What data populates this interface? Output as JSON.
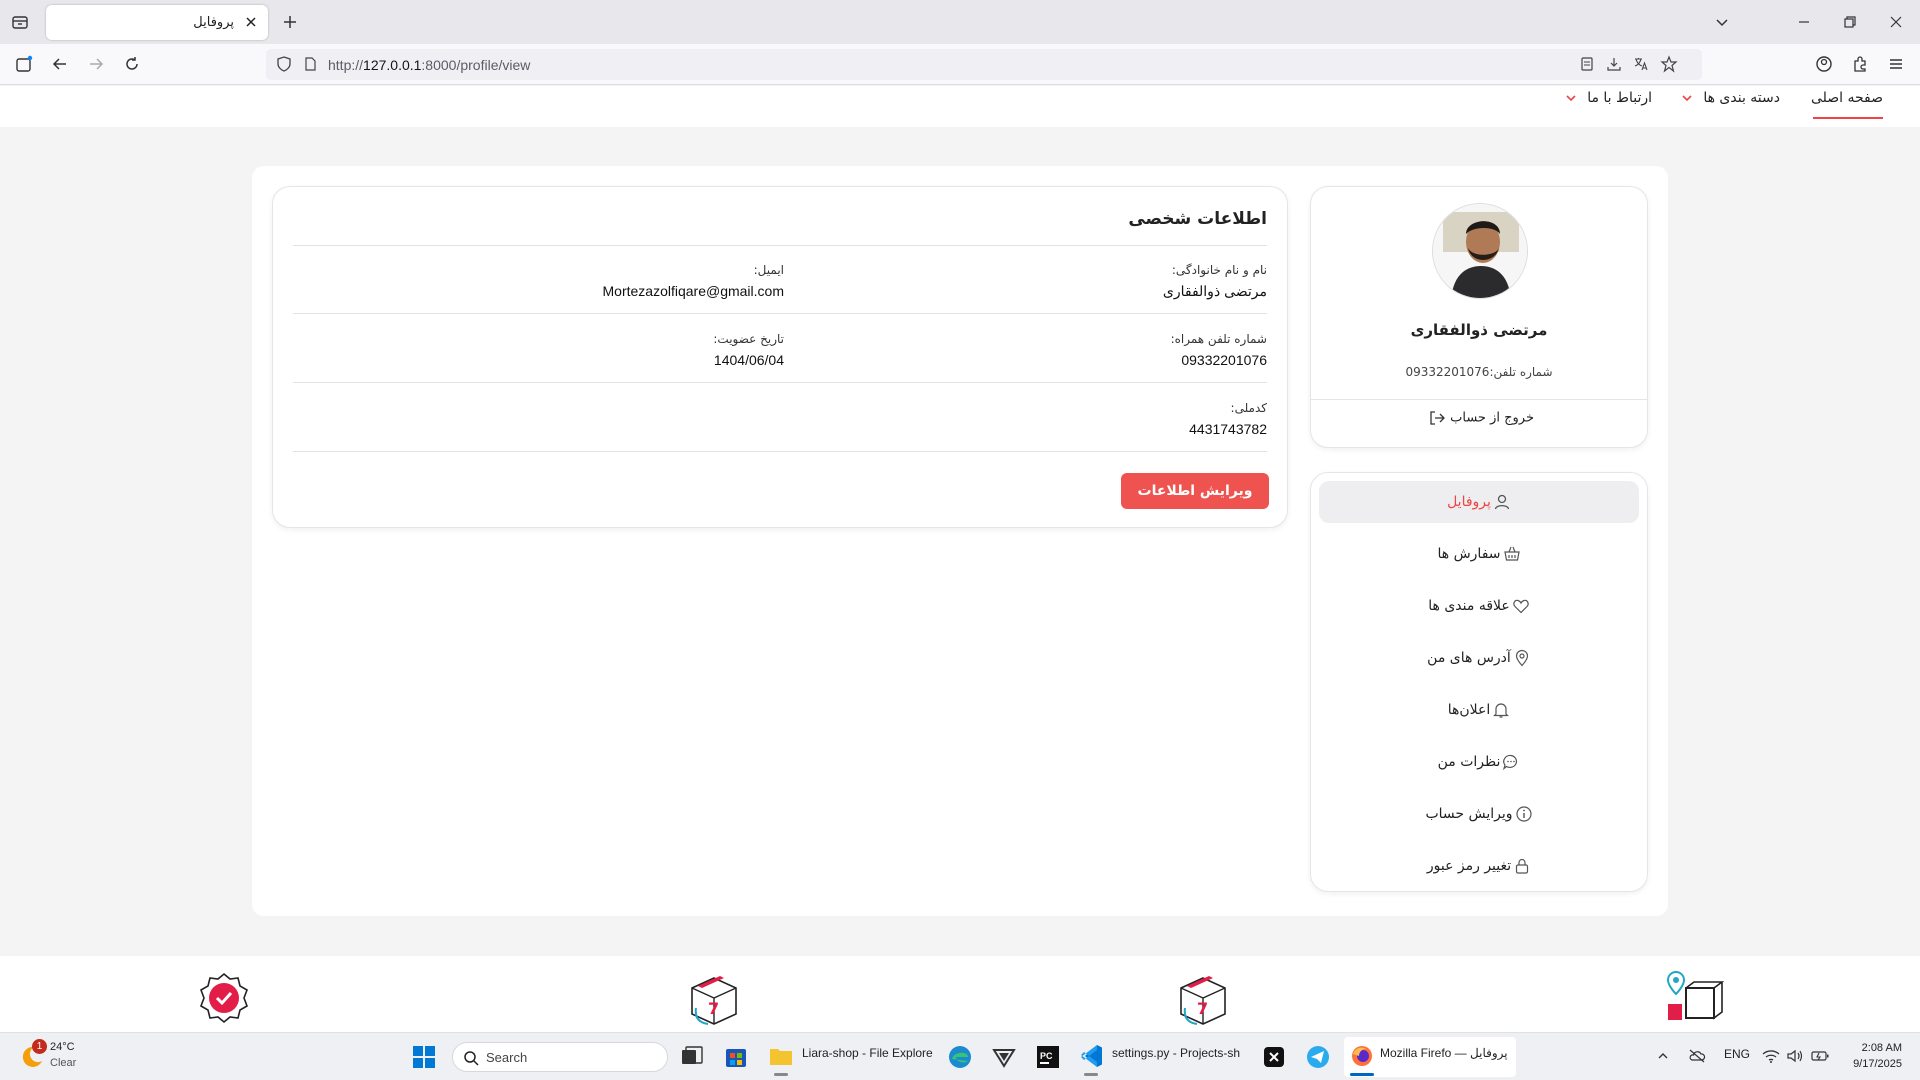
{
  "browser": {
    "tab_title": "پروفایل",
    "url_prefix": "http://",
    "url_host": "127.0.0.1",
    "url_rest": ":8000/profile/view"
  },
  "site_nav": {
    "home": "صفحه اصلی",
    "categories": "دسته بندی ها",
    "contact": "ارتباط با ما"
  },
  "personal_info": {
    "title": "اطلاعات شخصی",
    "fullname_label": "نام و نام خانوادگی:",
    "fullname_value": "مرتضی ذوالفقاری",
    "email_label": "ایمیل:",
    "email_value": "Mortezazolfiqare@gmail.com",
    "phone_label": "شماره تلفن همراه:",
    "phone_value": "09332201076",
    "member_since_label": "تاریخ عضویت:",
    "member_since_value": "1404/06/04",
    "national_code_label": "کدملی:",
    "national_code_value": "4431743782",
    "edit_button": "ویرایش اطلاعات"
  },
  "profile": {
    "name": "مرتضی ذوالفقاری",
    "phone_line": "شماره تلفن:09332201076",
    "logout": "خروج از حساب"
  },
  "menu": [
    {
      "label": "پروفایل",
      "icon": "user-icon",
      "active": true
    },
    {
      "label": "سفارش ها",
      "icon": "basket-icon",
      "active": false
    },
    {
      "label": "علاقه مندی ها",
      "icon": "heart-icon",
      "active": false
    },
    {
      "label": "آدرس های من",
      "icon": "location-icon",
      "active": false
    },
    {
      "label": "اعلان‌ها",
      "icon": "bell-icon",
      "active": false
    },
    {
      "label": "نظرات من",
      "icon": "comment-icon",
      "active": false
    },
    {
      "label": "ویرایش حساب",
      "icon": "info-icon",
      "active": false
    },
    {
      "label": "تغییر رمز عبور",
      "icon": "lock-icon",
      "active": false
    }
  ],
  "taskbar": {
    "weather_badge": "1",
    "weather_temp": "24°C",
    "weather_cond": "Clear",
    "search_placeholder": "Search",
    "explorer_label": "Liara-shop - File Explore",
    "vscode_label": "settings.py - Projects-sh",
    "firefox_label": "Mozilla Firefo — پروفایل",
    "lang": "ENG",
    "time": "2:08 AM",
    "date": "9/17/2025"
  },
  "colors": {
    "accent": "#ef4444",
    "button": "#ef5350"
  }
}
